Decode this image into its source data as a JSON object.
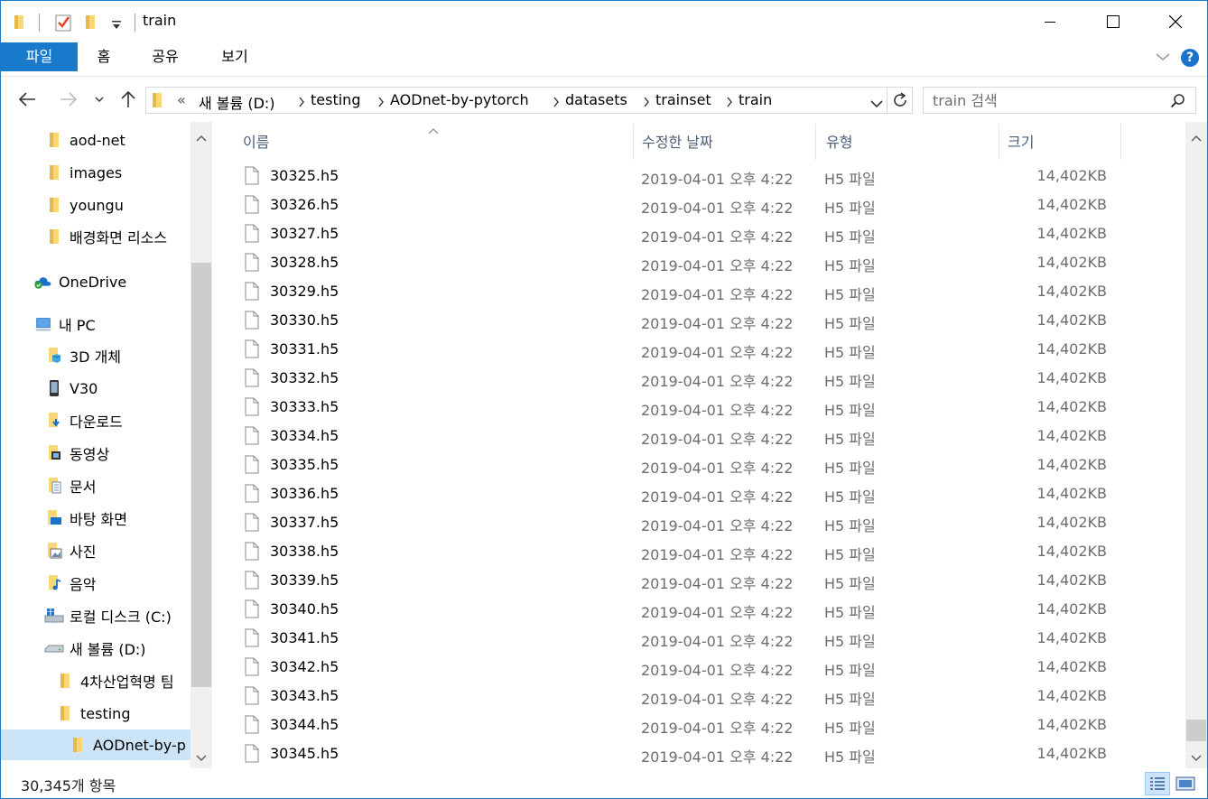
{
  "window": {
    "title": "train"
  },
  "ribbon": {
    "tabs": [
      {
        "label": "파일"
      },
      {
        "label": "홈"
      },
      {
        "label": "공유"
      },
      {
        "label": "보기"
      }
    ],
    "help_label": "?"
  },
  "address": {
    "overflow": "«",
    "segments": [
      "새 볼륨 (D:)",
      "testing",
      "AODnet-by-pytorch",
      "datasets",
      "trainset",
      "train"
    ]
  },
  "search": {
    "placeholder": "train 검색"
  },
  "sidebar": {
    "items": [
      {
        "label": "aod-net",
        "icon": "folder-icon"
      },
      {
        "label": "images",
        "icon": "folder-icon"
      },
      {
        "label": "youngu",
        "icon": "folder-icon"
      },
      {
        "label": "배경화면 리소스",
        "icon": "folder-icon"
      },
      {
        "label": "OneDrive",
        "icon": "onedrive-icon"
      },
      {
        "label": "내 PC",
        "icon": "pc-icon"
      },
      {
        "label": "3D 개체",
        "icon": "3d-objects-icon"
      },
      {
        "label": "V30",
        "icon": "phone-icon"
      },
      {
        "label": "다운로드",
        "icon": "downloads-icon"
      },
      {
        "label": "동영상",
        "icon": "videos-icon"
      },
      {
        "label": "문서",
        "icon": "documents-icon"
      },
      {
        "label": "바탕 화면",
        "icon": "desktop-icon"
      },
      {
        "label": "사진",
        "icon": "pictures-icon"
      },
      {
        "label": "음악",
        "icon": "music-icon"
      },
      {
        "label": "로컬 디스크 (C:)",
        "icon": "local-disk-icon"
      },
      {
        "label": "새 볼륨 (D:)",
        "icon": "drive-icon"
      },
      {
        "label": "4차산업혁명 팀",
        "icon": "folder-icon"
      },
      {
        "label": "testing",
        "icon": "folder-icon"
      },
      {
        "label": "AODnet-by-p",
        "icon": "folder-icon"
      }
    ]
  },
  "columns": {
    "name": "이름",
    "date": "수정한 날짜",
    "type": "유형",
    "size": "크기"
  },
  "files": [
    {
      "name": "30325.h5",
      "date": "2019-04-01 오후 4:22",
      "type": "H5 파일",
      "size": "14,402KB"
    },
    {
      "name": "30326.h5",
      "date": "2019-04-01 오후 4:22",
      "type": "H5 파일",
      "size": "14,402KB"
    },
    {
      "name": "30327.h5",
      "date": "2019-04-01 오후 4:22",
      "type": "H5 파일",
      "size": "14,402KB"
    },
    {
      "name": "30328.h5",
      "date": "2019-04-01 오후 4:22",
      "type": "H5 파일",
      "size": "14,402KB"
    },
    {
      "name": "30329.h5",
      "date": "2019-04-01 오후 4:22",
      "type": "H5 파일",
      "size": "14,402KB"
    },
    {
      "name": "30330.h5",
      "date": "2019-04-01 오후 4:22",
      "type": "H5 파일",
      "size": "14,402KB"
    },
    {
      "name": "30331.h5",
      "date": "2019-04-01 오후 4:22",
      "type": "H5 파일",
      "size": "14,402KB"
    },
    {
      "name": "30332.h5",
      "date": "2019-04-01 오후 4:22",
      "type": "H5 파일",
      "size": "14,402KB"
    },
    {
      "name": "30333.h5",
      "date": "2019-04-01 오후 4:22",
      "type": "H5 파일",
      "size": "14,402KB"
    },
    {
      "name": "30334.h5",
      "date": "2019-04-01 오후 4:22",
      "type": "H5 파일",
      "size": "14,402KB"
    },
    {
      "name": "30335.h5",
      "date": "2019-04-01 오후 4:22",
      "type": "H5 파일",
      "size": "14,402KB"
    },
    {
      "name": "30336.h5",
      "date": "2019-04-01 오후 4:22",
      "type": "H5 파일",
      "size": "14,402KB"
    },
    {
      "name": "30337.h5",
      "date": "2019-04-01 오후 4:22",
      "type": "H5 파일",
      "size": "14,402KB"
    },
    {
      "name": "30338.h5",
      "date": "2019-04-01 오후 4:22",
      "type": "H5 파일",
      "size": "14,402KB"
    },
    {
      "name": "30339.h5",
      "date": "2019-04-01 오후 4:22",
      "type": "H5 파일",
      "size": "14,402KB"
    },
    {
      "name": "30340.h5",
      "date": "2019-04-01 오후 4:22",
      "type": "H5 파일",
      "size": "14,402KB"
    },
    {
      "name": "30341.h5",
      "date": "2019-04-01 오후 4:22",
      "type": "H5 파일",
      "size": "14,402KB"
    },
    {
      "name": "30342.h5",
      "date": "2019-04-01 오후 4:22",
      "type": "H5 파일",
      "size": "14,402KB"
    },
    {
      "name": "30343.h5",
      "date": "2019-04-01 오후 4:22",
      "type": "H5 파일",
      "size": "14,402KB"
    },
    {
      "name": "30344.h5",
      "date": "2019-04-01 오후 4:22",
      "type": "H5 파일",
      "size": "14,402KB"
    },
    {
      "name": "30345.h5",
      "date": "2019-04-01 오후 4:22",
      "type": "H5 파일",
      "size": "14,402KB"
    }
  ],
  "status": {
    "item_count": "30,345개 항목"
  },
  "colors": {
    "accent": "#1979ca",
    "folder": "#f8d775",
    "selected": "#cce4f7"
  }
}
